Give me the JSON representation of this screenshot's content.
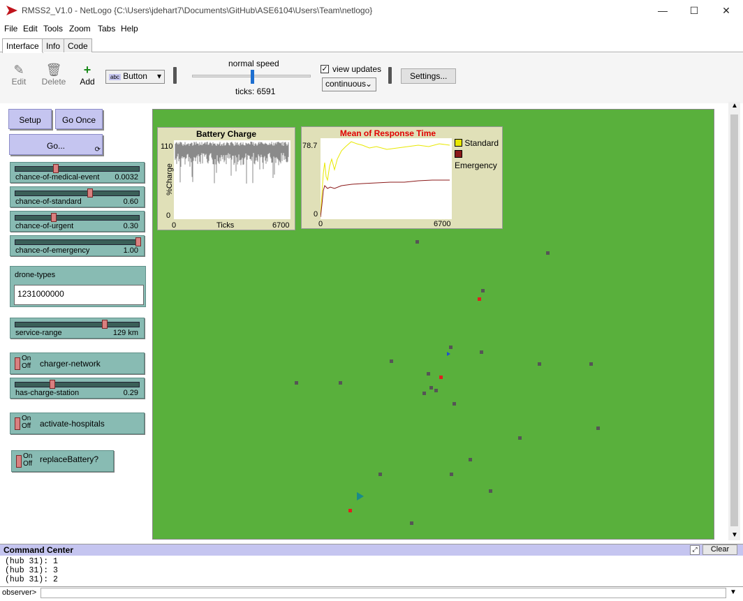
{
  "window": {
    "title": "RMSS2_V1.0 - NetLogo {C:\\Users\\jdehart7\\Documents\\GitHub\\ASE6104\\Users\\Team\\netlogo}",
    "minimize": "—",
    "maximize": "☐",
    "close": "✕"
  },
  "menu": [
    "File",
    "Edit",
    "Tools",
    "Zoom",
    "Tabs",
    "Help"
  ],
  "tabs": [
    "Interface",
    "Info",
    "Code"
  ],
  "toolbar": {
    "edit": "Edit",
    "delete": "Delete",
    "add": "Add",
    "widget_type": "Button",
    "speed_label": "normal speed",
    "ticks": "ticks: 6591",
    "view_updates": "view updates",
    "update_mode": "continuous",
    "settings": "Settings...",
    "speed_fraction": 0.5
  },
  "widgets": {
    "setup": "Setup",
    "go_once": "Go Once",
    "go": "Go...",
    "sliders": [
      {
        "label": "chance-of-medical-event",
        "value": "0.0032",
        "fraction": 0.32
      },
      {
        "label": "chance-of-standard",
        "value": "0.60",
        "fraction": 0.6
      },
      {
        "label": "chance-of-urgent",
        "value": "0.30",
        "fraction": 0.3
      },
      {
        "label": "chance-of-emergency",
        "value": "1.00",
        "fraction": 1.0
      }
    ],
    "drone_types": {
      "label": "drone-types",
      "value": "1231000000"
    },
    "service_range": {
      "label": "service-range",
      "value": "129 km",
      "fraction": 0.72
    },
    "charger_network": {
      "label": "charger-network",
      "on": "On",
      "off": "Off"
    },
    "has_charge_station": {
      "label": "has-charge-station",
      "value": "0.29",
      "fraction": 0.29
    },
    "activate_hospitals": {
      "label": "activate-hospitals",
      "on": "On",
      "off": "Off"
    },
    "replace_battery": {
      "label": "replaceBattery?",
      "on": "On",
      "off": "Off"
    }
  },
  "plots": {
    "battery": {
      "title": "Battery Charge",
      "ylabel": "%Charge",
      "xlabel": "Ticks",
      "ymax": "110",
      "ymin": "0",
      "xmin": "0",
      "xmax": "6700"
    },
    "response": {
      "title": "Mean of Response Time",
      "ymax": "78.7",
      "ymin": "0",
      "xmin": "0",
      "xmax": "6700",
      "legend": [
        {
          "name": "Standard",
          "color": "#e8e800"
        },
        {
          "name": "Emergency",
          "color": "#8b1a1a"
        }
      ]
    }
  },
  "command_center": {
    "title": "Command Center",
    "clear": "Clear",
    "output": [
      "(hub 31): 1",
      "(hub 31): 3",
      "(hub 31): 2"
    ],
    "prompt": "observer>"
  },
  "colors": {
    "world": "#59b03c",
    "button": "#c5c5f0",
    "widget": "#88bbb3"
  }
}
